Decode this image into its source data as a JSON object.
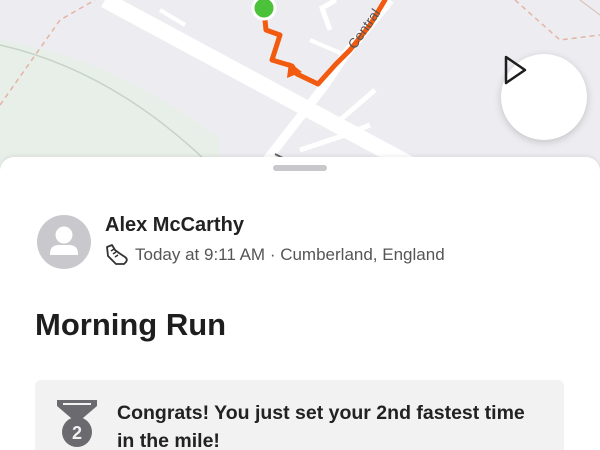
{
  "map": {
    "street_label": "Central",
    "route_color": "#f25a0f",
    "start_marker_color": "#4cc23a",
    "background_color": "#ededf1"
  },
  "controls": {
    "play_icon": "play-icon"
  },
  "sheet": {
    "athlete": {
      "name": "Alex McCarthy",
      "avatar_icon": "user-avatar-icon"
    },
    "meta": {
      "sport_icon": "shoe-icon",
      "text": "Today at 9:11 AM · Cumberland, England"
    },
    "activity_title": "Morning Run",
    "achievement": {
      "icon": "medal-icon",
      "rank": "2",
      "text": "Congrats! You just set your 2nd fastest time in the mile!"
    }
  }
}
